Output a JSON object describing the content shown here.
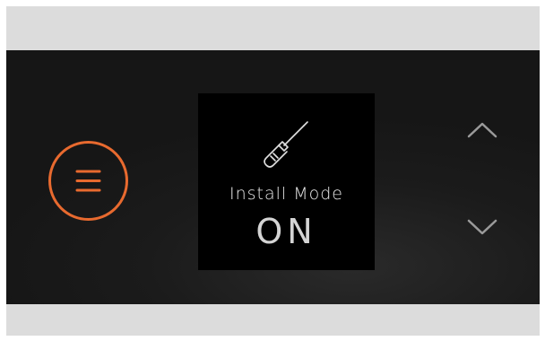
{
  "display": {
    "title": "Install Mode",
    "value": "ON",
    "icon": "screwdriver-icon"
  },
  "controls": {
    "menu_icon": "hamburger-menu-icon",
    "up_icon": "chevron-up-icon",
    "down_icon": "chevron-down-icon"
  },
  "colors": {
    "accent": "#e86a2f",
    "panel_background": "#1b1b1b",
    "display_background": "#000000",
    "frame": "#dcdcdc",
    "text": "#e9e9e9"
  }
}
